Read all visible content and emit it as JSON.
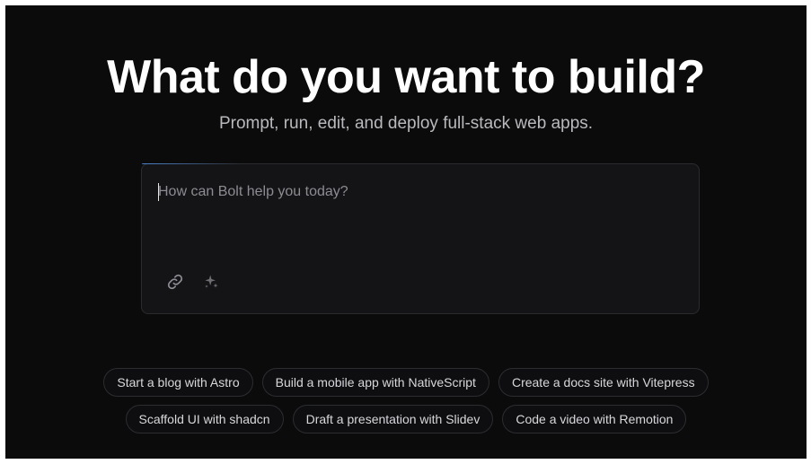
{
  "hero": {
    "title": "What do you want to build?",
    "subtitle": "Prompt, run, edit, and deploy full-stack web apps."
  },
  "prompt": {
    "placeholder": "How can Bolt help you today?",
    "value": "",
    "attach_icon": "link-icon",
    "enhance_icon": "sparkles-icon"
  },
  "suggestions": {
    "row1": [
      {
        "label": "Start a blog with Astro"
      },
      {
        "label": "Build a mobile app with NativeScript"
      },
      {
        "label": "Create a docs site with Vitepress"
      }
    ],
    "row2": [
      {
        "label": "Scaffold UI with shadcn"
      },
      {
        "label": "Draft a presentation with Slidev"
      },
      {
        "label": "Code a video with Remotion"
      }
    ]
  },
  "colors": {
    "background": "#0b0b0c",
    "panel": "#141416",
    "accent": "#508cdc"
  }
}
